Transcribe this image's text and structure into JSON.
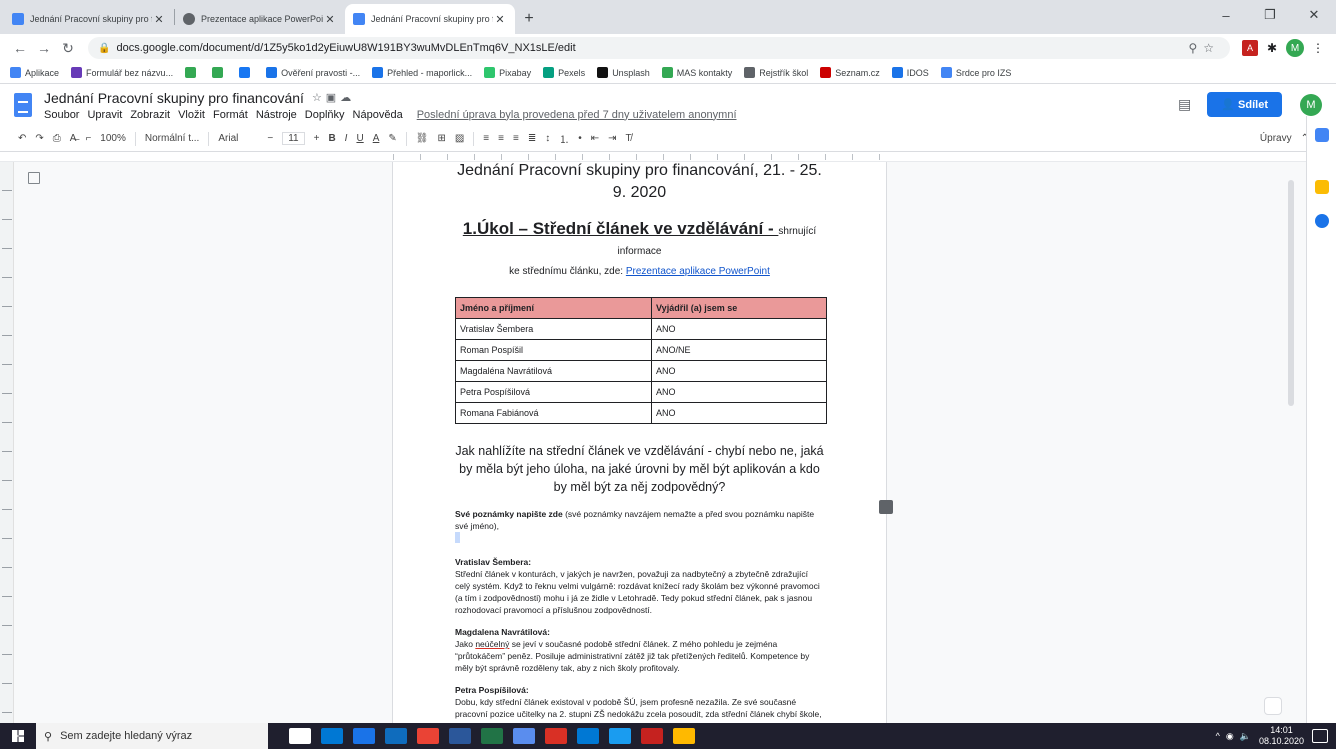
{
  "browser": {
    "tabs": [
      {
        "title": "Jednání Pracovní skupiny pro fina",
        "icon": "docs",
        "active": false
      },
      {
        "title": "Prezentace aplikace PowerPoint",
        "icon": "chrome",
        "active": false
      },
      {
        "title": "Jednání Pracovní skupiny pro fina",
        "icon": "docs",
        "active": true
      }
    ],
    "new_tab": "+",
    "url": "docs.google.com/document/d/1Z5y5ko1d2yEiuwU8W191BY3wuMvDLEnTmq6V_NX1sLE/edit",
    "bookmarks": [
      {
        "label": "Aplikace",
        "color": "#4285f4"
      },
      {
        "label": "Formulář bez názvu...",
        "color": "#673ab7"
      },
      {
        "label": "",
        "color": "#34a853"
      },
      {
        "label": "",
        "color": "#34a853"
      },
      {
        "label": "",
        "color": "#1877f2"
      },
      {
        "label": "Ověření pravosti -...",
        "color": "#1a73e8"
      },
      {
        "label": "Přehled - maporlick...",
        "color": "#1a73e8"
      },
      {
        "label": "Pixabay",
        "color": "#2ec66d"
      },
      {
        "label": "Pexels",
        "color": "#05a081"
      },
      {
        "label": "Unsplash",
        "color": "#111111"
      },
      {
        "label": "MAS kontakty",
        "color": "#34a853"
      },
      {
        "label": "Rejstřík škol",
        "color": "#5f6368"
      },
      {
        "label": "Seznam.cz",
        "color": "#cc0000"
      },
      {
        "label": "IDOS",
        "color": "#1a73e8"
      },
      {
        "label": "Srdce pro IZS",
        "color": "#4285f4"
      }
    ],
    "profile_initial": "M"
  },
  "docs": {
    "title": "Jednání Pracovní skupiny pro financování",
    "menus": [
      "Soubor",
      "Upravit",
      "Zobrazit",
      "Vložit",
      "Formát",
      "Nástroje",
      "Doplňky",
      "Nápověda"
    ],
    "last_edit": "Poslední úprava byla provedena před 7 dny uživatelem anonymní",
    "share_label": "Sdílet",
    "user_initial": "M",
    "toolbar": {
      "zoom": "100%",
      "style": "Normální t...",
      "font": "Arial",
      "size": "11",
      "mode": "Úpravy"
    }
  },
  "document": {
    "heading": "Jednání Pracovní skupiny pro financování, 21. - 25. 9. 2020",
    "task_title": "1.Úkol – Střední článek ve vzdělávání - ",
    "task_sub": "shrnující informace",
    "task_line2": "ke střednímu článku, zde: ",
    "task_link": "Prezentace aplikace PowerPoint",
    "table": {
      "headers": [
        "Jméno a příjmení",
        "Vyjádřil (a) jsem se"
      ],
      "rows": [
        [
          "Vratislav Šembera",
          "ANO"
        ],
        [
          "Roman Pospíšil",
          "ANO/NE"
        ],
        [
          "Magdaléna Navrátilová",
          "ANO"
        ],
        [
          "Petra Pospíšilová",
          "ANO"
        ],
        [
          "Romana Fabiánová",
          "ANO"
        ]
      ]
    },
    "question": "Jak nahlížíte na střední článek ve vzdělávání - chybí nebo ne, jaká by měla být jeho úloha, na jaké úrovni by měl být aplikován a kdo by měl být za něj zodpovědný?",
    "notes_intro_bold": "Své poznámky napište zde",
    "notes_intro_rest": " (své poznámky navzájem nemažte a před svou poznámku napište své jméno),",
    "notes": [
      {
        "author": "Vratislav Šembera:",
        "text": "Střední článek v konturách, v jakých je navržen, považuji za nadbytečný a zbytečně zdražující celý systém. Když to řeknu velmi vulgárně: rozdávat knížecí rady školám bez výkonné pravomoci (a tím i zodpovědnosti) mohu i já ze židle v Letohradě. Tedy pokud střední článek, pak s jasnou rozhodovací pravomocí a příslušnou zodpovědností."
      },
      {
        "author": "Magdalena Navrátilová:",
        "text_pre": "Jako ",
        "text_underlined": "neúčelný",
        "text_post": " se jeví v současné podobě střední článek. Z mého pohledu je  zejména “průtokáčem” peněz.   Posiluje administrativní zátěž již tak přetížených ředitelů. Kompetence by měly být správně rozděleny tak, aby z nich školy profitovaly."
      },
      {
        "author": "Petra Pospíšilová:",
        "text": "Dobu, kdy střední článek existoval v podobě ŠÚ, jsem profesně nezažila. Ze své současné pracovní pozice učitelky na 2. stupni ZŠ nedokážu zcela posoudit, zda střední článek chybí škole, jako učitelce mi nechybí.  Souhlasím s kolegy, že má-li střední článek existovat a být efektivní, musí mít pravomoc (a ta musí být školami respektována) a zodpovědnost. Ale proč zřizovat další článek řízení, nemohou toto vykonávat krajští úředníci?"
      }
    ]
  },
  "taskbar": {
    "search_placeholder": "Sem zadejte hledaný výraz",
    "apps": [
      "#ffffff",
      "#0078d4",
      "#1a73e8",
      "#0f6cbd",
      "#ea4335",
      "#2b579a",
      "#217346",
      "#5a8dee",
      "#d93025",
      "#0078d4",
      "#1a9cf0",
      "#c5221f",
      "#ffb900"
    ],
    "time": "14:01",
    "date": "08.10.2020"
  }
}
